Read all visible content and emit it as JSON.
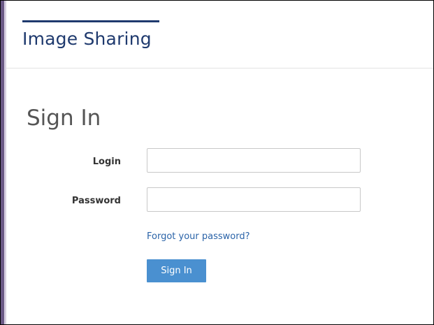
{
  "header": {
    "brand": "Image Sharing"
  },
  "page": {
    "title": "Sign In"
  },
  "form": {
    "login": {
      "label": "Login",
      "value": "",
      "placeholder": ""
    },
    "password": {
      "label": "Password",
      "value": "",
      "placeholder": ""
    },
    "forgot_link": "Forgot your password?",
    "submit_label": "Sign In"
  },
  "colors": {
    "brand": "#1f3a6e",
    "link": "#2a63a8",
    "button": "#4a90d0",
    "left_border": "#6b5a86"
  }
}
